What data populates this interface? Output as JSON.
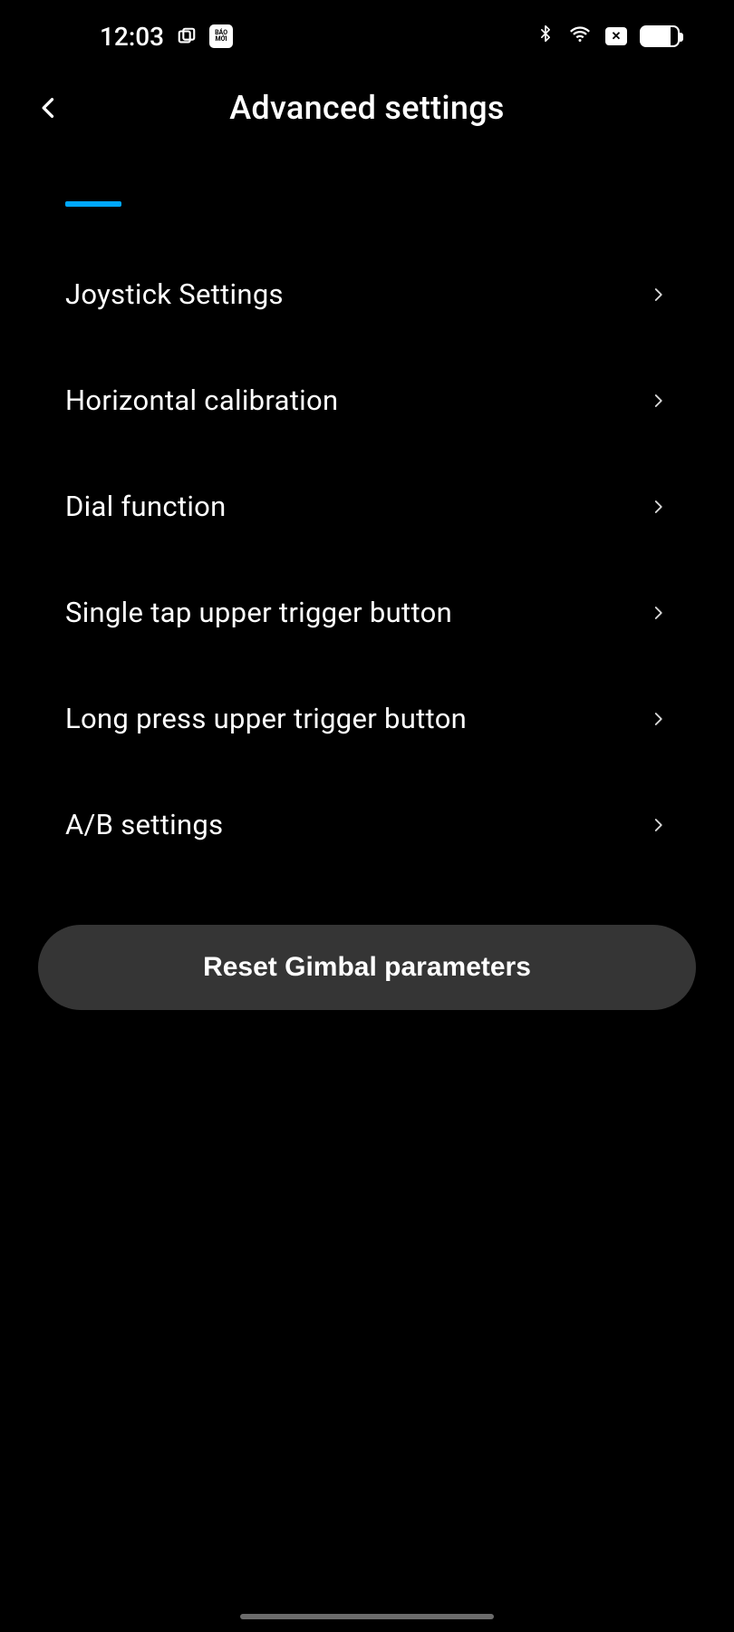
{
  "statusBar": {
    "time": "12:03",
    "appBadge": "BÁO MỚI"
  },
  "header": {
    "title": "Advanced settings"
  },
  "menu": {
    "items": [
      {
        "label": "Joystick Settings"
      },
      {
        "label": "Horizontal calibration"
      },
      {
        "label": "Dial function"
      },
      {
        "label": "Single tap upper trigger button"
      },
      {
        "label": "Long press upper trigger button"
      },
      {
        "label": "A/B settings"
      }
    ]
  },
  "actions": {
    "resetLabel": "Reset Gimbal parameters"
  }
}
